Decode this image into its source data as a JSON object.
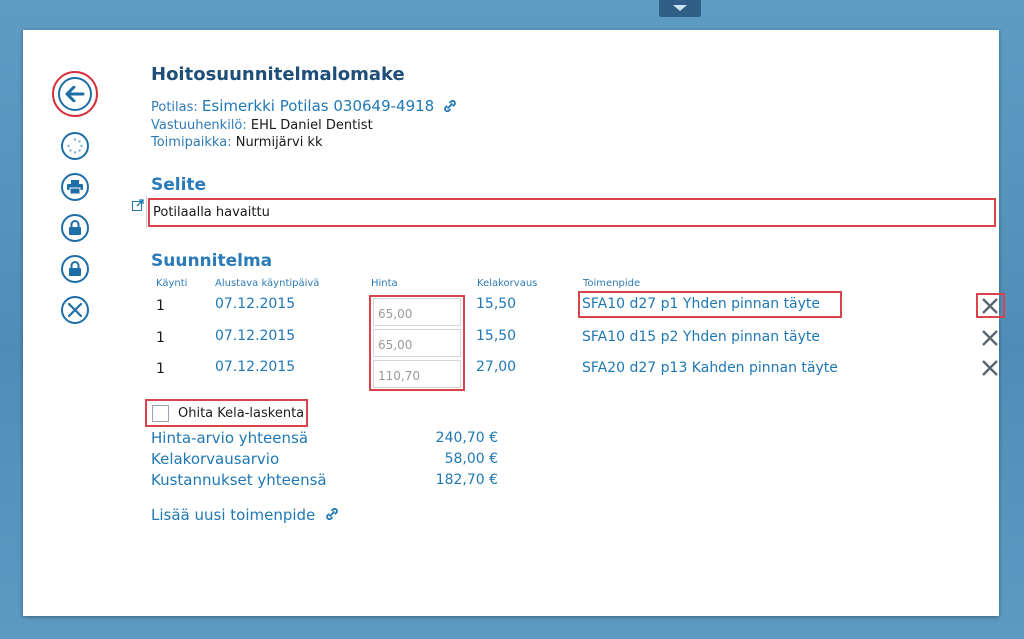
{
  "form": {
    "title": "Hoitosuunnitelmalomake",
    "patient_label": "Potilas:",
    "patient_value": "Esimerkki Potilas 030649-4918",
    "responsible_label": "Vastuuhenkilö:",
    "responsible_value": "EHL Daniel Dentist",
    "location_label": "Toimipaikka:",
    "location_value": "Nurmijärvi kk"
  },
  "selite": {
    "heading": "Selite",
    "value": "Potilaalla havaittu"
  },
  "plan": {
    "heading": "Suunnitelma",
    "columns": {
      "visit": "Käynti",
      "date": "Alustava käyntipäivä",
      "price": "Hinta",
      "kela": "Kelakorvaus",
      "procedure": "Toimenpide"
    },
    "rows": [
      {
        "visit": "1",
        "date": "07.12.2015",
        "price": "65,00",
        "kela": "15,50",
        "procedure": "SFA10 d27 p1 Yhden pinnan täyte"
      },
      {
        "visit": "1",
        "date": "07.12.2015",
        "price": "65,00",
        "kela": "15,50",
        "procedure": "SFA10 d15 p2 Yhden pinnan täyte"
      },
      {
        "visit": "1",
        "date": "07.12.2015",
        "price": "110,70",
        "kela": "27,00",
        "procedure": "SFA20 d27 p13 Kahden pinnan täyte"
      }
    ]
  },
  "skip_kela": {
    "label": "Ohita Kela-laskenta",
    "checked": false
  },
  "summary": {
    "total_label": "Hinta-arvio yhteensä",
    "total_value": "240,70 €",
    "kela_label": "Kelakorvausarvio",
    "kela_value": "58,00 €",
    "cost_label": "Kustannukset yhteensä",
    "cost_value": "182,70 €"
  },
  "add_procedure": "Lisää uusi toimenpide",
  "icons": {
    "rail": [
      "back-arrow-icon",
      "loading-spinner-icon",
      "print-icon",
      "lock-icon",
      "lock-icon",
      "close-circle-icon"
    ]
  },
  "colors": {
    "accent": "#1f78b4",
    "highlight": "#d9434b",
    "heading": "#1f4e79"
  }
}
